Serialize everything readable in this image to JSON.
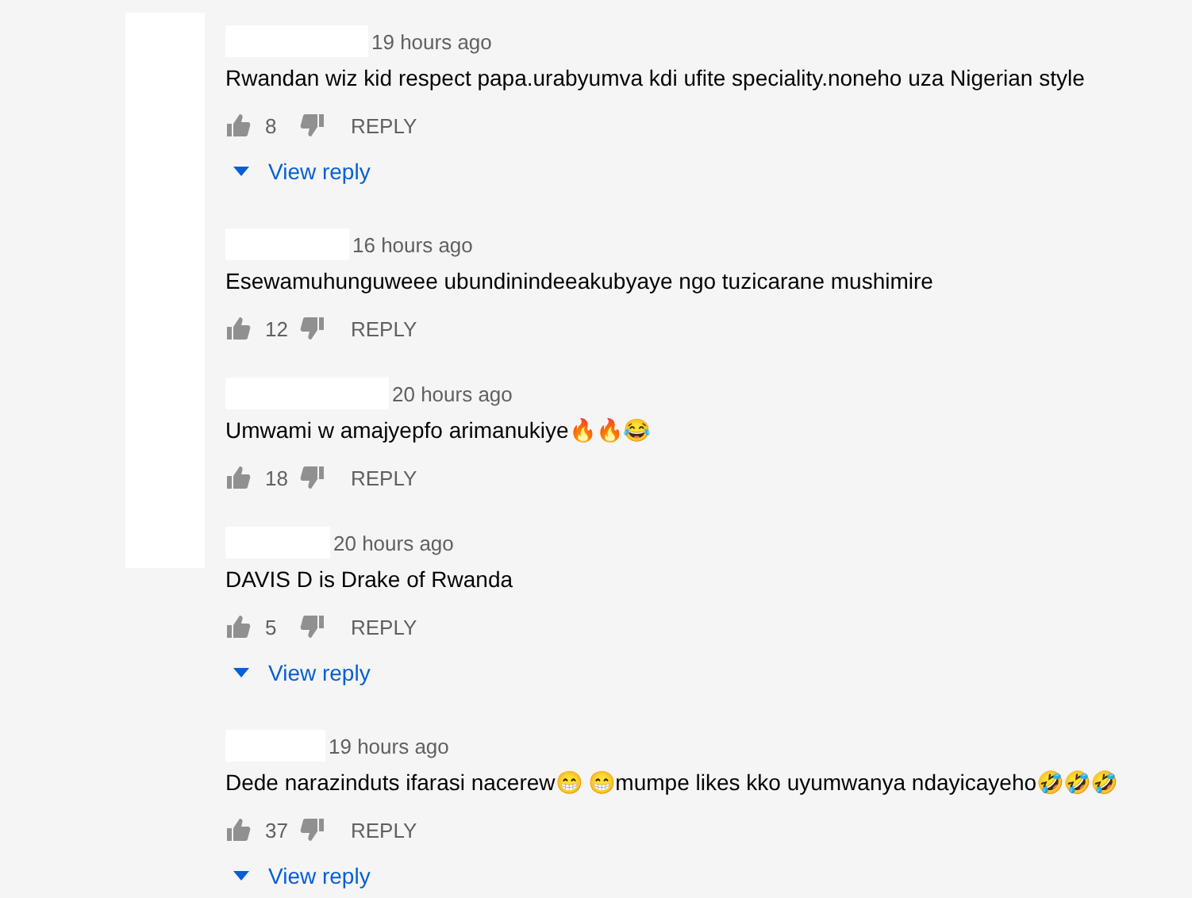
{
  "comments": [
    {
      "time": "19 hours ago",
      "text": "Rwandan wiz kid respect papa.urabyumva kdi ufite speciality.noneho uza Nigerian style",
      "likes": "8",
      "reply": "REPLY",
      "view_reply": "View reply"
    },
    {
      "time": "16 hours ago",
      "text": "Esewamuhunguweee ubundinindeeakubyaye ngo tuzicarane mushimire",
      "likes": "12",
      "reply": "REPLY"
    },
    {
      "time": "20 hours ago",
      "text": "Umwami w amajyepfo arimanukiye🔥🔥😂",
      "likes": "18",
      "reply": "REPLY"
    },
    {
      "time": "20 hours ago",
      "text": "DAVIS D is Drake of Rwanda",
      "likes": "5",
      "reply": "REPLY",
      "view_reply": "View reply"
    },
    {
      "time": "19 hours ago",
      "text": "Dede narazinduts ifarasi nacerew😁 😁mumpe likes kko uyumwanya ndayicayeho🤣🤣🤣",
      "likes": "37",
      "reply": "REPLY",
      "view_reply": "View reply"
    }
  ]
}
